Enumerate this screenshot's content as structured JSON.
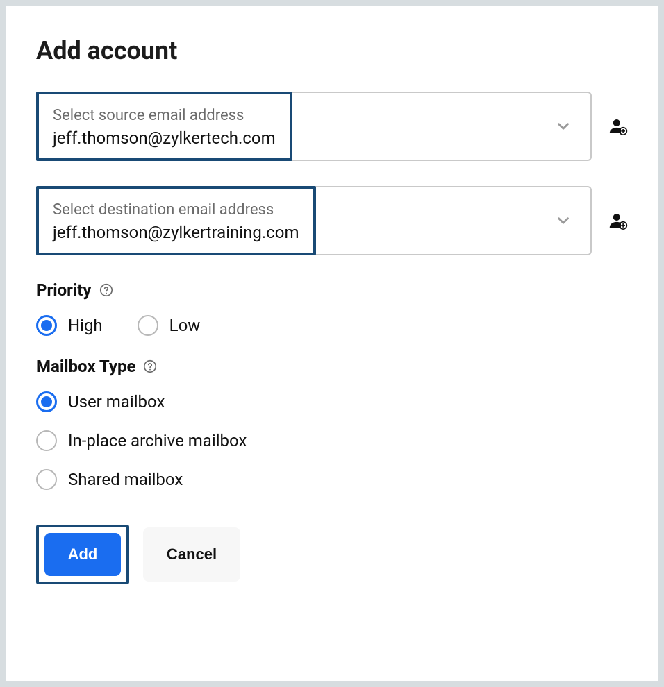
{
  "title": "Add account",
  "source": {
    "label": "Select source email address",
    "value": "jeff.thomson@zylkertech.com"
  },
  "destination": {
    "label": "Select destination email address",
    "value": "jeff.thomson@zylkertraining.com"
  },
  "priority": {
    "label": "Priority",
    "options": {
      "high": "High",
      "low": "Low"
    },
    "selected": "high"
  },
  "mailbox": {
    "label": "Mailbox Type",
    "options": {
      "user": "User mailbox",
      "archive": "In-place archive mailbox",
      "shared": "Shared mailbox"
    },
    "selected": "user"
  },
  "buttons": {
    "add": "Add",
    "cancel": "Cancel"
  }
}
